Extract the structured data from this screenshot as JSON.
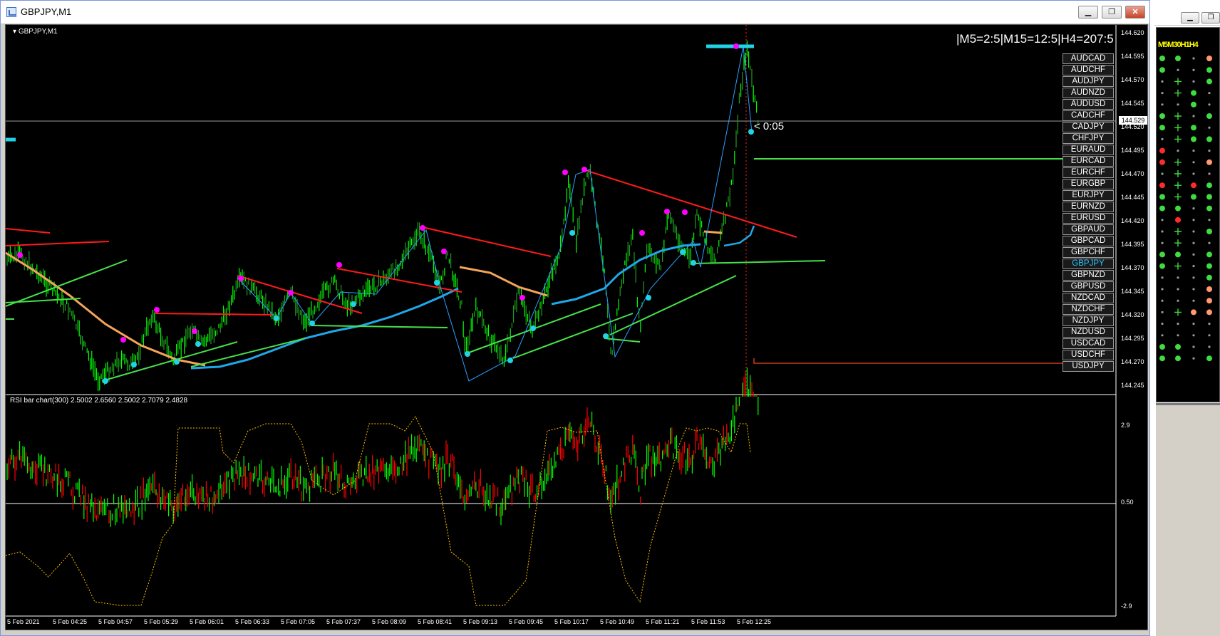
{
  "window": {
    "title": "GBPJPY,M1",
    "minimize_label": "▁",
    "maximize_label": "❐",
    "close_label": "✕"
  },
  "chart": {
    "symbol_label": "GBPJPY,M1",
    "info_text": "|M5=2:5|M15=12:5|H4=207:5",
    "timer_label": "< 0:05",
    "rsi_label": "RSI bar chart(300) 2.5002 2.6560 2.5002 2.7079 2.4828",
    "current_price": "144.529",
    "price_axis": [
      "144.620",
      "144.595",
      "144.570",
      "144.545",
      "144.520",
      "144.495",
      "144.470",
      "144.445",
      "144.420",
      "144.395",
      "144.370",
      "144.345",
      "144.320",
      "144.295",
      "144.270",
      "144.245"
    ],
    "rsi_axis": [
      "2.9",
      "0.50",
      "-2.9"
    ],
    "time_axis": [
      "5 Feb 2021",
      "5 Feb 04:25",
      "5 Feb 04:57",
      "5 Feb 05:29",
      "5 Feb 06:01",
      "5 Feb 06:33",
      "5 Feb 07:05",
      "5 Feb 07:37",
      "5 Feb 08:09",
      "5 Feb 08:41",
      "5 Feb 09:13",
      "5 Feb 09:45",
      "5 Feb 10:17",
      "5 Feb 10:49",
      "5 Feb 11:21",
      "5 Feb 11:53",
      "5 Feb 12:25"
    ],
    "colors": {
      "bull": "#00ff00",
      "bear": "#ff0000",
      "ma_blue": "#1fa8e8",
      "ma_orange": "#f5a45a",
      "trend_red": "#ff1a1a",
      "trend_green": "#46e04a",
      "marker_magenta": "#ff00ff",
      "marker_cyan": "#22d3e6",
      "rsi_dotted": "#ffbf00"
    }
  },
  "symbols": [
    {
      "label": "AUDCAD",
      "active": false
    },
    {
      "label": "AUDCHF",
      "active": false
    },
    {
      "label": "AUDJPY",
      "active": false
    },
    {
      "label": "AUDNZD",
      "active": false
    },
    {
      "label": "AUDUSD",
      "active": false
    },
    {
      "label": "CADCHF",
      "active": false
    },
    {
      "label": "CADJPY",
      "active": false
    },
    {
      "label": "CHFJPY",
      "active": false
    },
    {
      "label": "EURAUD",
      "active": false
    },
    {
      "label": "EURCAD",
      "active": false
    },
    {
      "label": "EURCHF",
      "active": false
    },
    {
      "label": "EURGBP",
      "active": false
    },
    {
      "label": "EURJPY",
      "active": false
    },
    {
      "label": "EURNZD",
      "active": false
    },
    {
      "label": "EURUSD",
      "active": false
    },
    {
      "label": "GBPAUD",
      "active": false
    },
    {
      "label": "GBPCAD",
      "active": false
    },
    {
      "label": "GBPCHF",
      "active": false
    },
    {
      "label": "GBPJPY",
      "active": true
    },
    {
      "label": "GBPNZD",
      "active": false
    },
    {
      "label": "GBPUSD",
      "active": false
    },
    {
      "label": "NZDCAD",
      "active": false
    },
    {
      "label": "NZDCHF",
      "active": false
    },
    {
      "label": "NZDJPY",
      "active": false
    },
    {
      "label": "NZDUSD",
      "active": false
    },
    {
      "label": "USDCAD",
      "active": false
    },
    {
      "label": "USDCHF",
      "active": false
    },
    {
      "label": "USDJPY",
      "active": false
    }
  ],
  "side_panel": {
    "header": "M5M30H1H4",
    "rows": [
      [
        "g",
        "g",
        "n",
        "o"
      ],
      [
        "g",
        "n",
        "n",
        "g"
      ],
      [
        "n",
        "x",
        "n",
        "g"
      ],
      [
        "n",
        "x",
        "g",
        "n"
      ],
      [
        "n",
        "n",
        "g",
        "n"
      ],
      [
        "g",
        "x",
        "n",
        "g"
      ],
      [
        "g",
        "x",
        "g",
        "n"
      ],
      [
        "n",
        "x",
        "g",
        "g"
      ],
      [
        "r",
        "n",
        "n",
        "n"
      ],
      [
        "r",
        "x",
        "n",
        "o"
      ],
      [
        "n",
        "x",
        "n",
        "n"
      ],
      [
        "r",
        "x",
        "r",
        "g"
      ],
      [
        "g",
        "x",
        "g",
        "g"
      ],
      [
        "g",
        "g",
        "n",
        "g"
      ],
      [
        "n",
        "r",
        "n",
        "n"
      ],
      [
        "n",
        "x",
        "n",
        "g"
      ],
      [
        "n",
        "x",
        "n",
        "n"
      ],
      [
        "g",
        "g",
        "n",
        "g"
      ],
      [
        "g",
        "x",
        "n",
        "g"
      ],
      [
        "n",
        "n",
        "n",
        "g"
      ],
      [
        "n",
        "n",
        "n",
        "o"
      ],
      [
        "n",
        "n",
        "n",
        "o"
      ],
      [
        "n",
        "x",
        "o",
        "o"
      ],
      [
        "n",
        "n",
        "n",
        "n"
      ],
      [
        "n",
        "n",
        "n",
        "n"
      ],
      [
        "g",
        "g",
        "n",
        "n"
      ],
      [
        "g",
        "g",
        "n",
        "g"
      ]
    ]
  }
}
